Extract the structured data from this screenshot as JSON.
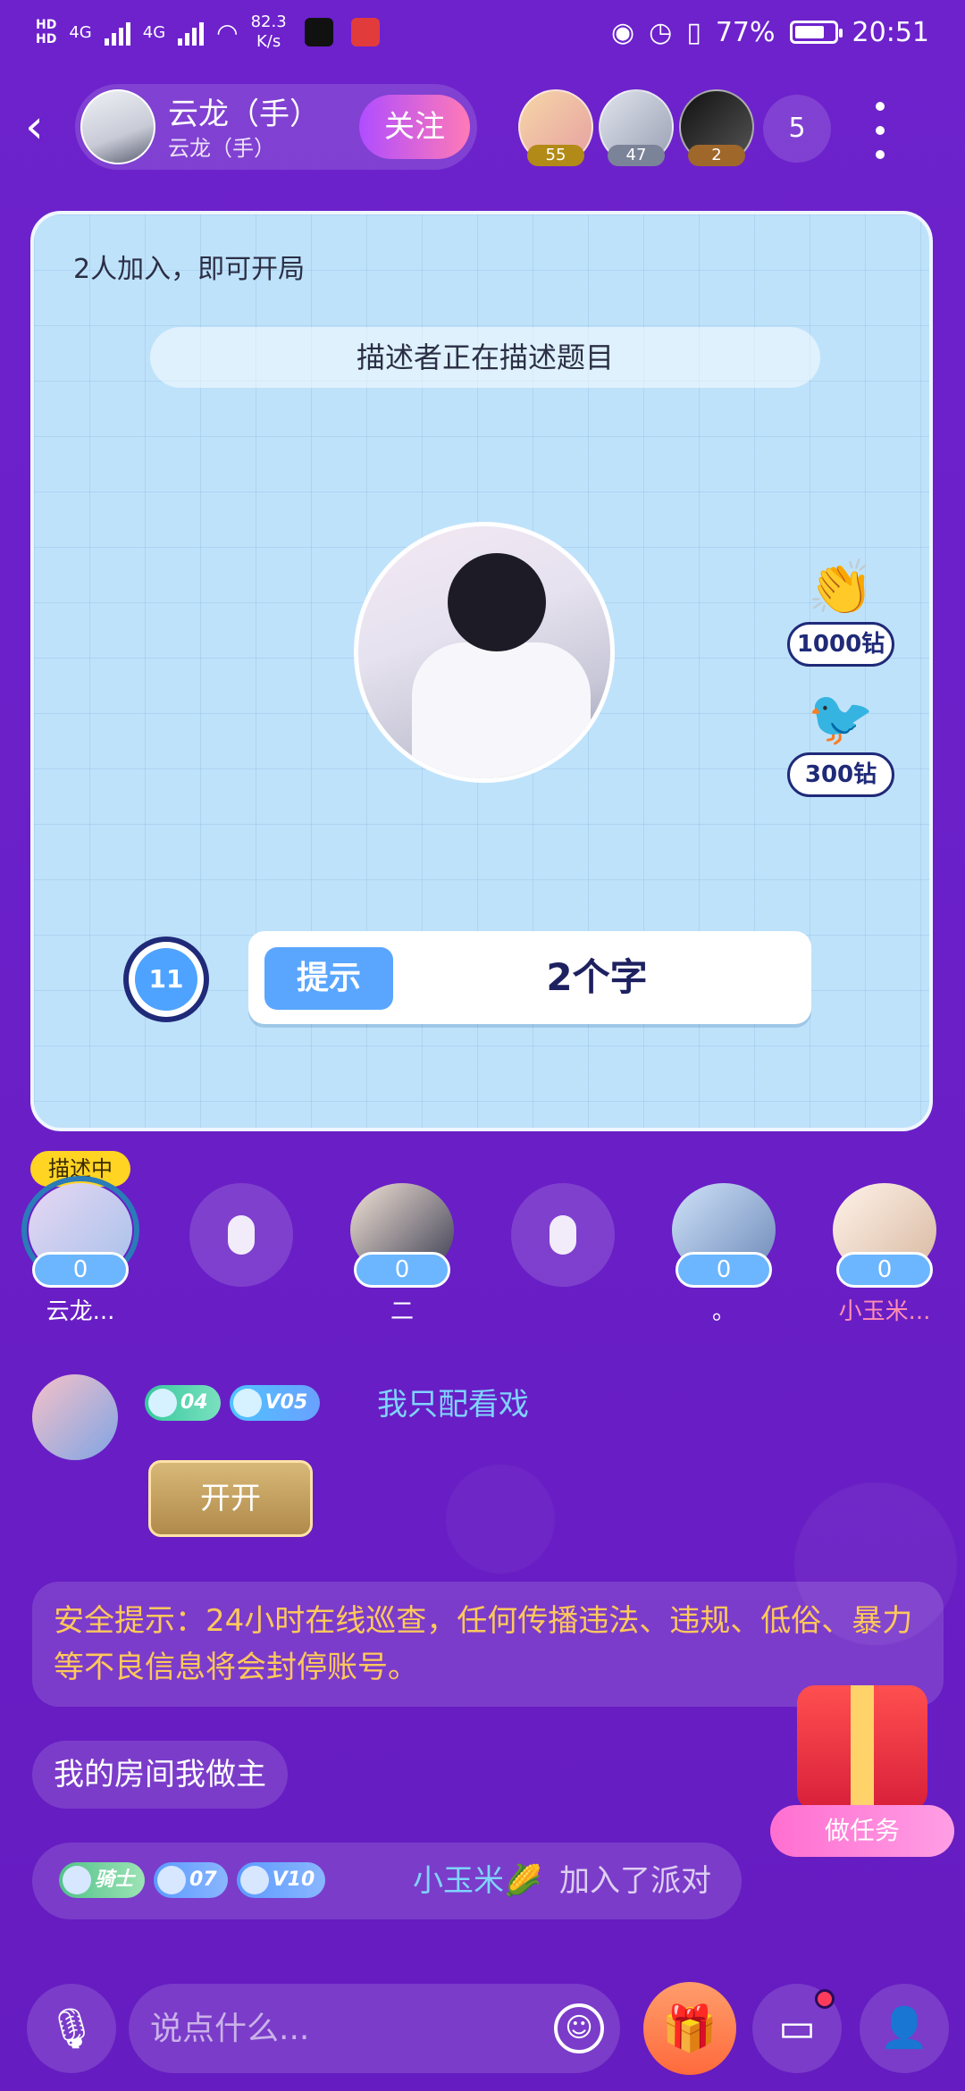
{
  "status_bar": {
    "hd1": "HD",
    "hd2": "HD",
    "net1": "4G",
    "net2": "4G",
    "speed_value": "82.3",
    "speed_unit": "K/s",
    "battery": "77%",
    "battery_level": 0.77,
    "time": "20:51"
  },
  "header": {
    "host_name": "云龙（手）",
    "host_sub": "云龙（手）",
    "follow_label": "关注",
    "members": [
      {
        "count": "55"
      },
      {
        "count": "47"
      },
      {
        "count": "2"
      }
    ],
    "member_total": "5"
  },
  "board": {
    "status": "2人加入，即可开局",
    "banner": "描述者正在描述题目",
    "timer": "11",
    "hint_label": "提示",
    "hint_value": "2个字",
    "gifts": [
      {
        "icon": "high-five-icon",
        "price": "1000钻"
      },
      {
        "icon": "crow-icon",
        "price": "300钻"
      }
    ]
  },
  "seats": {
    "speaking_label": "描述中",
    "list": [
      {
        "name": "云龙...",
        "count": "0"
      },
      {
        "name": "二",
        "count": "0"
      },
      {
        "name": "。",
        "count": "0"
      },
      {
        "name": "小玉米...",
        "count": "0"
      }
    ]
  },
  "chat": {
    "msg1": {
      "badge1": "04",
      "badge2": "V05",
      "user": "我只配看戏",
      "bubble": "开开"
    },
    "notice": "安全提示：24小时在线巡查，任何传播违法、违规、低俗、暴力等不良信息将会封停账号。",
    "msg2": "我的房间我做主",
    "join": {
      "badge1": "骑士",
      "badge2": "07",
      "badge3": "V10",
      "user": "小玉米🌽",
      "text": "加入了派对"
    }
  },
  "task": {
    "label": "做任务"
  },
  "bottom_bar": {
    "input_placeholder": "说点什么..."
  },
  "colors": {
    "background": "#6a1fc7",
    "board": "#bfe2fb",
    "accent": "#5aa6ff",
    "notice_text": "#ffc85a"
  }
}
